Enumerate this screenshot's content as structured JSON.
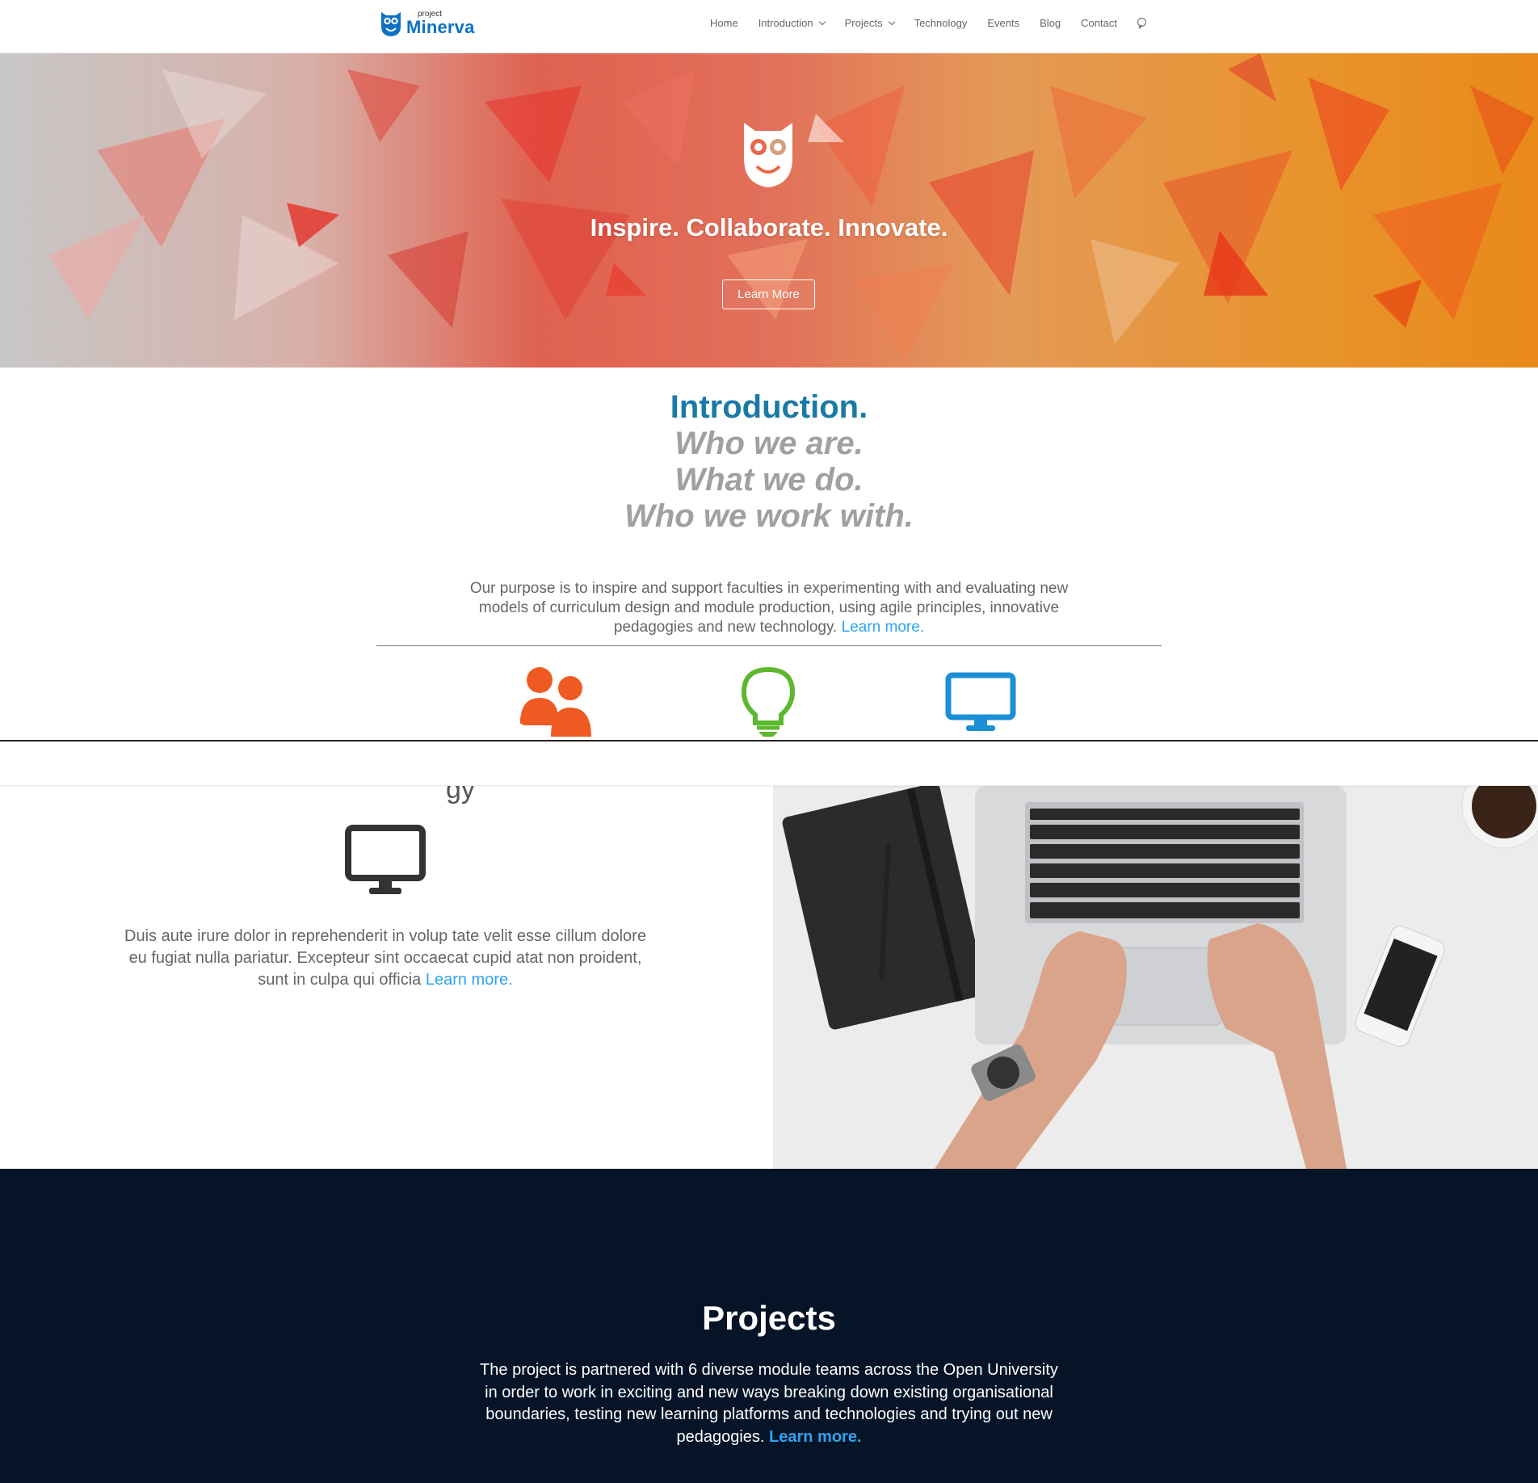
{
  "brand": {
    "small": "project",
    "name": "Minerva",
    "accent": "#0c71c3"
  },
  "nav": {
    "items": [
      {
        "label": "Home",
        "dropdown": false
      },
      {
        "label": "Introduction",
        "dropdown": true
      },
      {
        "label": "Projects",
        "dropdown": true
      },
      {
        "label": "Technology",
        "dropdown": false
      },
      {
        "label": "Events",
        "dropdown": false
      },
      {
        "label": "Blog",
        "dropdown": false
      },
      {
        "label": "Contact",
        "dropdown": false
      }
    ],
    "search_icon": "search-icon"
  },
  "hero": {
    "title": "Inspire. Collaborate. Innovate.",
    "button": "Learn More",
    "icon": "owl-logo-icon"
  },
  "intro": {
    "title": "Introduction.",
    "sub1": "Who we are.",
    "sub2": "What we do.",
    "sub3": "Who we work with.",
    "text": "Our purpose is to inspire and support faculties in experimenting with and evaluating new models of curriculum design and module production, using agile principles, innovative pedagogies and new technology.",
    "link": "Learn more.",
    "link_color": "#2ea3f2",
    "title_color": "#1a7aa6",
    "icons": [
      {
        "name": "people-icon",
        "color": "#f05a22"
      },
      {
        "name": "lightbulb-icon",
        "color": "#5cb82e"
      },
      {
        "name": "monitor-icon",
        "color": "#1b8fd6"
      }
    ]
  },
  "tech": {
    "heading_fragment": "gy",
    "text": "Duis aute irure dolor in reprehenderit in volup tate velit esse cillum dolore eu fugiat nulla pariatur. Excepteur sint occaecat cupid atat non proident, sunt in culpa qui officia",
    "link": "Learn more.",
    "icon": "monitor-icon",
    "image": "laptop-desk-photo"
  },
  "projects": {
    "title": "Projects",
    "text": "The project is partnered with 6 diverse module teams across the Open University in order to work in exciting and new ways breaking down existing organisational boundaries, testing new learning platforms and technologies and trying out new pedagogies.",
    "link": "Learn more.",
    "background": "#051427"
  }
}
